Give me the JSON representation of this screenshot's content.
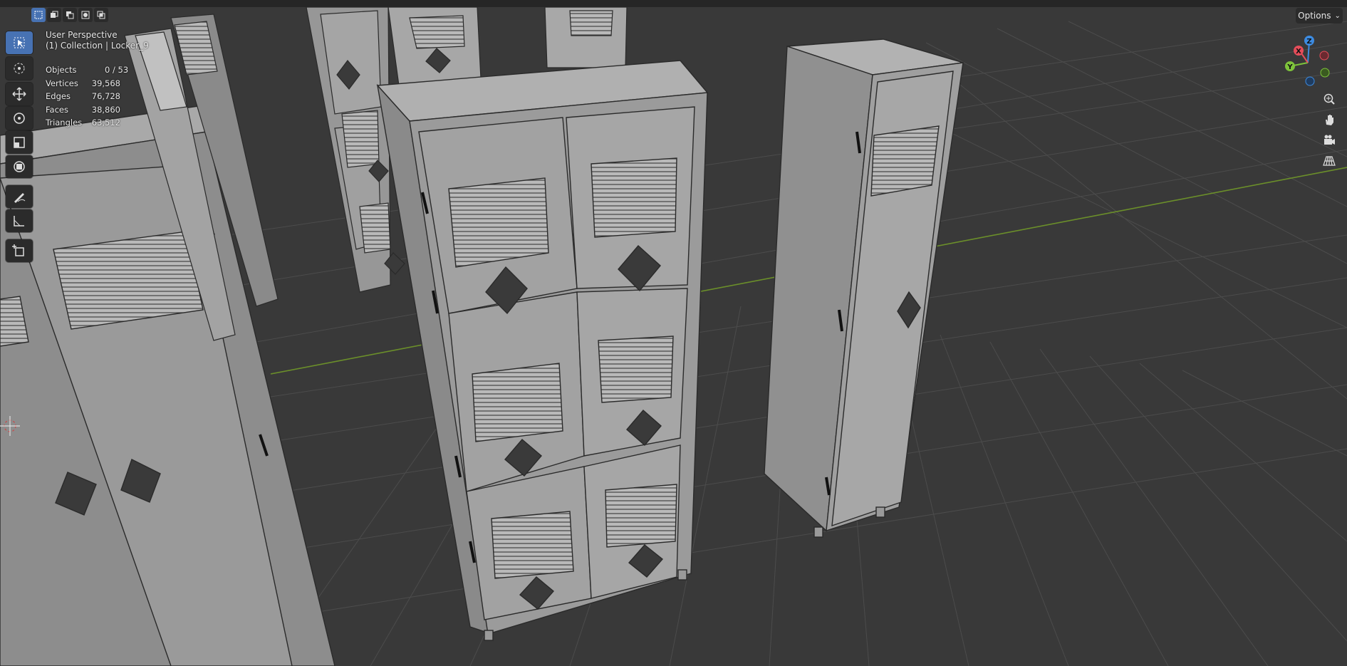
{
  "viewport": {
    "view_name": "User Perspective",
    "collection_path": "(1) Collection | Locker_9"
  },
  "stats": [
    {
      "label": "Objects",
      "value": "0 / 53"
    },
    {
      "label": "Vertices",
      "value": "39,568"
    },
    {
      "label": "Edges",
      "value": "76,728"
    },
    {
      "label": "Faces",
      "value": "38,860"
    },
    {
      "label": "Triangles",
      "value": "63,512"
    }
  ],
  "header": {
    "options_label": "Options",
    "select_modes": [
      "select-set-icon",
      "select-extend-icon",
      "select-subtract-icon",
      "select-invert-icon",
      "select-intersect-icon"
    ]
  },
  "toolbar": {
    "tools": [
      "select-box-icon",
      "cursor-icon",
      "move-icon",
      "rotate-icon",
      "scale-icon",
      "transform-icon",
      "annotate-icon",
      "measure-icon",
      "add-cube-icon"
    ]
  },
  "navigation_gizmo": {
    "axes": [
      "X",
      "Y",
      "Z"
    ],
    "buttons": [
      "zoom-icon",
      "hand-pan-icon",
      "camera-icon",
      "grid-perspective-icon"
    ]
  },
  "colors": {
    "background": "#393939",
    "grid": "#4a4a4a",
    "x_axis": "#8a3a3a",
    "y_axis": "#6b8f2a",
    "active_tool": "#4772b3",
    "axis_x_red": "#e54d5a",
    "axis_y_green": "#7ec33b",
    "axis_z_blue": "#3d8be0"
  }
}
